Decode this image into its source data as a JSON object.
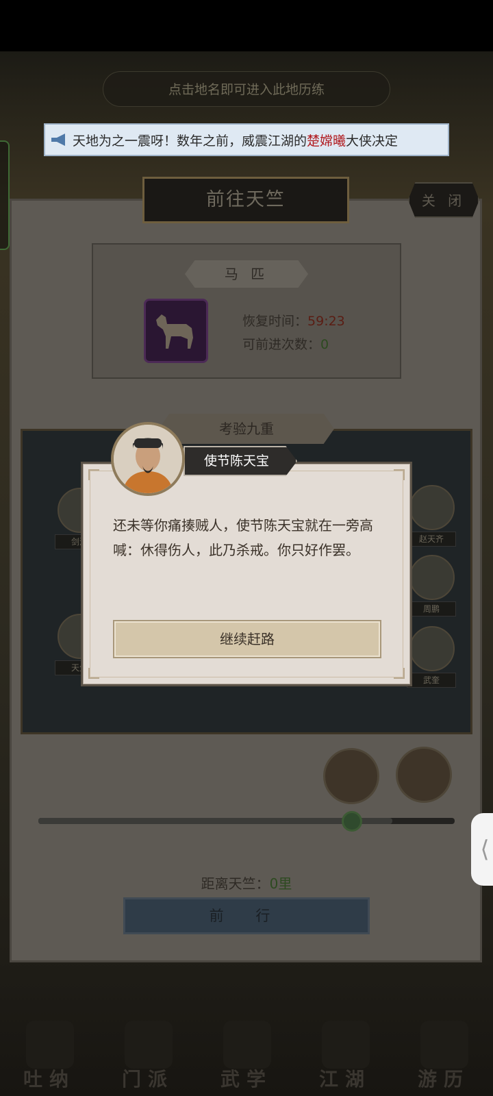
{
  "top_hint": "点击地名即可进入此地历练",
  "notice": {
    "prefix": "天地为之一震呀！数年之前，威震江湖的",
    "highlight": "楚嫦曦",
    "suffix": "大侠决定"
  },
  "panel": {
    "title": "前往天竺",
    "close_label": "关 闭",
    "horse": {
      "label": "马 匹",
      "recover_label": "恢复时间：",
      "recover_value": "59:23",
      "trips_label": "可前进次数：",
      "trips_value": "0"
    },
    "exam_label": "考验九重",
    "npcs_left": [
      "剑浮",
      "天生"
    ],
    "npcs_right": [
      "赵天齐",
      "周鹏",
      "武奎"
    ],
    "progress_fraction": 0.85,
    "distance_label": "距离天竺：",
    "distance_value": "0里",
    "go_label": "前 行"
  },
  "event": {
    "speaker": "使节陈天宝",
    "body": "还未等你痛揍贼人，使节陈天宝就在一旁高喊：休得伤人，此乃杀戒。你只好作罢。",
    "continue_label": "继续赶路"
  },
  "bottom_nav": [
    "吐纳",
    "门派",
    "武学",
    "江湖",
    "游历"
  ],
  "side_tab_glyph": "⟨",
  "colors": {
    "notice_highlight": "#b0191e",
    "modal_bg": "#e3dcd5",
    "button_bg": "#d4c6aa"
  }
}
